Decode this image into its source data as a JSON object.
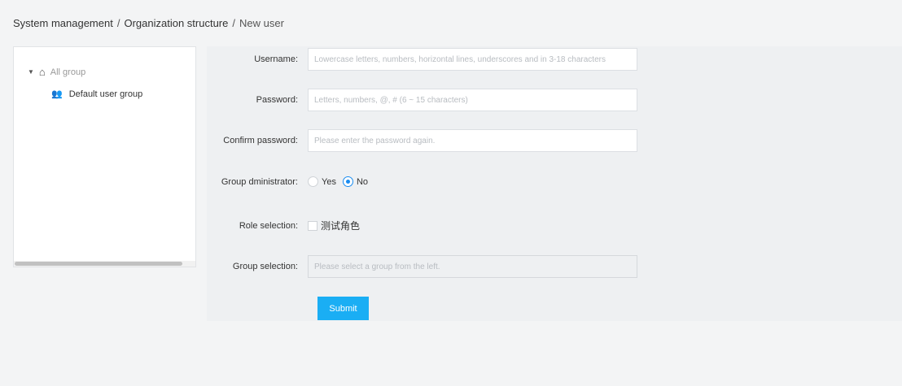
{
  "breadcrumb": {
    "items": [
      "System management",
      "Organization structure",
      "New user"
    ],
    "separator": "/"
  },
  "tree": {
    "root_label": "All group",
    "root_icon": "home-icon",
    "children": [
      {
        "label": "Default user group",
        "icon": "users-icon"
      }
    ]
  },
  "form": {
    "username": {
      "label": "Username:",
      "value": "",
      "placeholder": "Lowercase letters, numbers, horizontal lines, underscores and in 3-18 characters"
    },
    "password": {
      "label": "Password:",
      "value": "",
      "placeholder": "Letters, numbers, @, # (6 ~ 15 characters)"
    },
    "confirm_password": {
      "label": "Confirm password:",
      "value": "",
      "placeholder": "Please enter the password again."
    },
    "group_admin": {
      "label": "Group dministrator:",
      "options": [
        "Yes",
        "No"
      ],
      "selected": "No"
    },
    "role_selection": {
      "label": "Role selection:",
      "options": [
        {
          "label": "测试角色",
          "checked": false
        }
      ]
    },
    "group_selection": {
      "label": "Group selection:",
      "placeholder": "Please select a group from the left."
    },
    "submit_label": "Submit"
  },
  "colors": {
    "accent": "#1a8cf0",
    "submit": "#1aaef4",
    "background": "#f3f4f5"
  }
}
